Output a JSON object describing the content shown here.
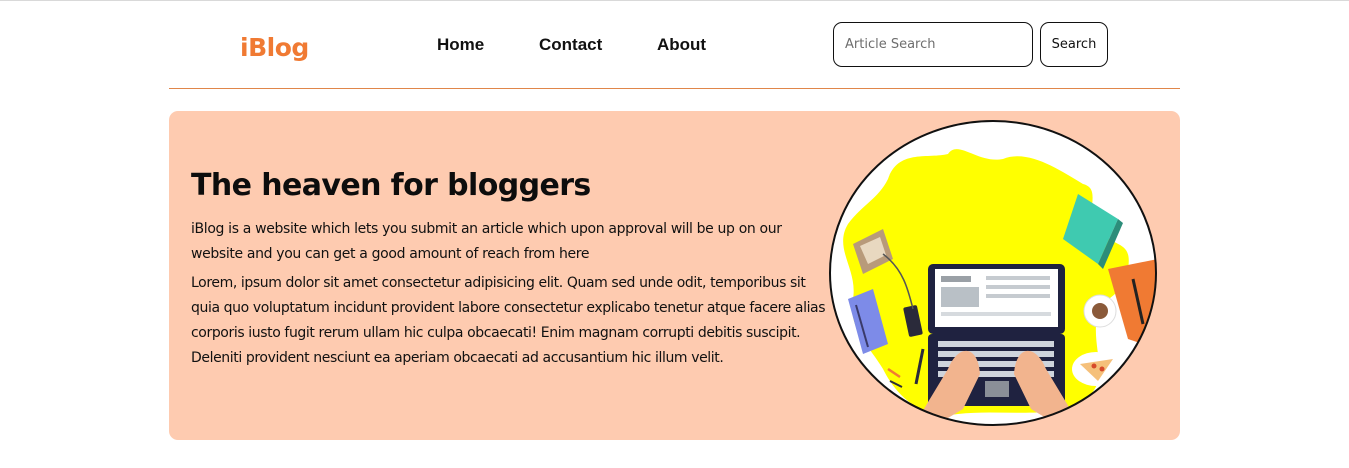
{
  "brand": {
    "logo_text": "iBlog"
  },
  "nav": {
    "links": [
      {
        "label": "Home"
      },
      {
        "label": "Contact"
      },
      {
        "label": "About"
      }
    ]
  },
  "search": {
    "placeholder": "Article Search",
    "value": "",
    "button_label": "Search"
  },
  "hero": {
    "title": "The heaven for bloggers",
    "lead": "iBlog is a website which lets you submit an article which upon approval will be up on our website and you can get a good amount of reach from here",
    "body": "Lorem, ipsum dolor sit amet consectetur adipisicing elit. Quam sed unde odit, temporibus sit quia quo voluptatum incidunt provident labore consectetur explicabo tenetur atque facere alias corporis iusto fugit rerum ullam hic culpa obcaecati! Enim magnam corrupti debitis suscipit. Deleniti provident nesciunt ea aperiam obcaecati ad accusantium hic illum velit.",
    "illustration_icon": "laptop-workspace-illustration"
  },
  "colors": {
    "accent": "#f07a33",
    "hero_background": "#fecbb0",
    "illustration_yellow": "#ffff00"
  }
}
